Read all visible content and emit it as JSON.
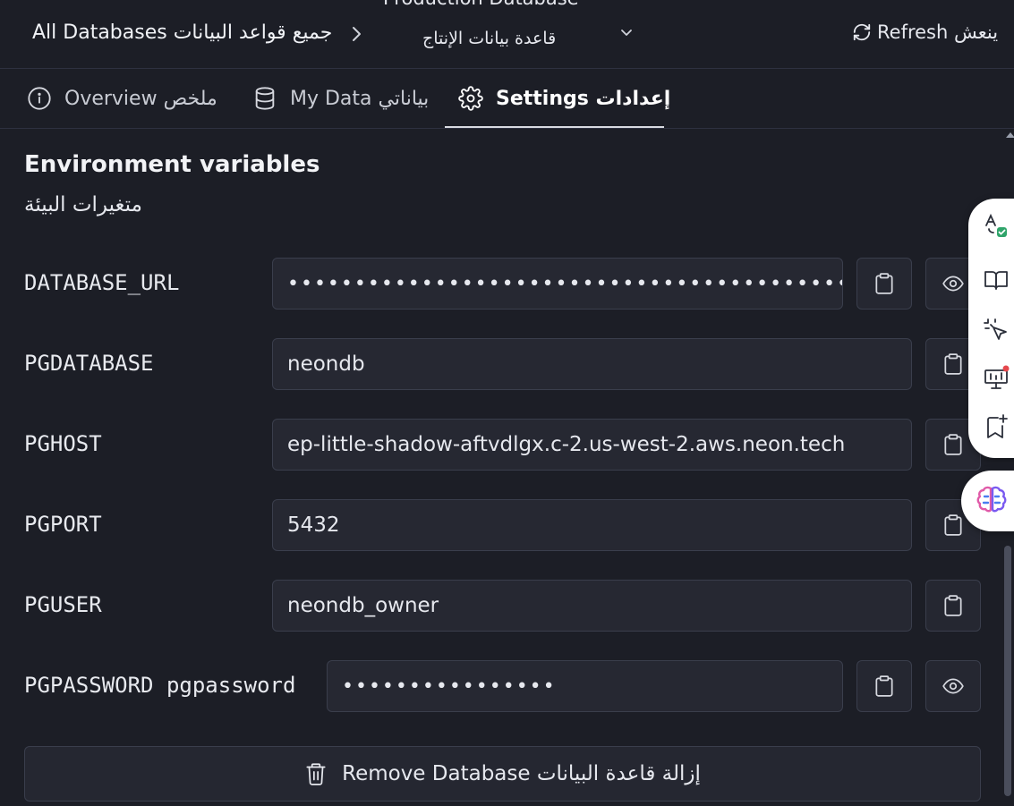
{
  "header": {
    "breadcrumb_all": "All Databases جميع قواعد البيانات",
    "db_name_en": "Production Database",
    "db_name_ar": "قاعدة بيانات الإنتاج",
    "refresh_label": "Refresh ينعش"
  },
  "tabs": [
    {
      "label": "Overview ملخص",
      "icon": "info-icon",
      "active": false
    },
    {
      "label": "My Data بياناتي",
      "icon": "database-icon",
      "active": false
    },
    {
      "label": "Settings إعدادات",
      "icon": "gear-icon",
      "active": true
    }
  ],
  "env": {
    "title": "Environment variables",
    "subtitle": "متغيرات البيئة",
    "vars": [
      {
        "name": "DATABASE_URL",
        "value": "••••••••••••••••••••••••••••••••••••••••••••••••••••••••••••••",
        "masked": true
      },
      {
        "name": "PGDATABASE",
        "value": "neondb",
        "masked": false
      },
      {
        "name": "PGHOST",
        "value": "ep-little-shadow-aftvdlgx.c-2.us-west-2.aws.neon.tech",
        "masked": false
      },
      {
        "name": "PGPORT",
        "value": "5432",
        "masked": false
      },
      {
        "name": "PGUSER",
        "value": "neondb_owner",
        "masked": false
      },
      {
        "name": "PGPASSWORD pgpassword",
        "value": "••••••••••••••••",
        "masked": true
      }
    ]
  },
  "remove_label": "Remove Database إزالة قاعدة البيانات",
  "colors": {
    "background": "#1c1e26",
    "field": "#262832",
    "border": "#3a3e4c",
    "text": "#e6e8ee"
  },
  "dock_icons": [
    "translate-check-icon",
    "book-icon",
    "sparkle-cursor-icon",
    "presentation-icon",
    "bookmark-plus-icon",
    "brain-icon"
  ]
}
